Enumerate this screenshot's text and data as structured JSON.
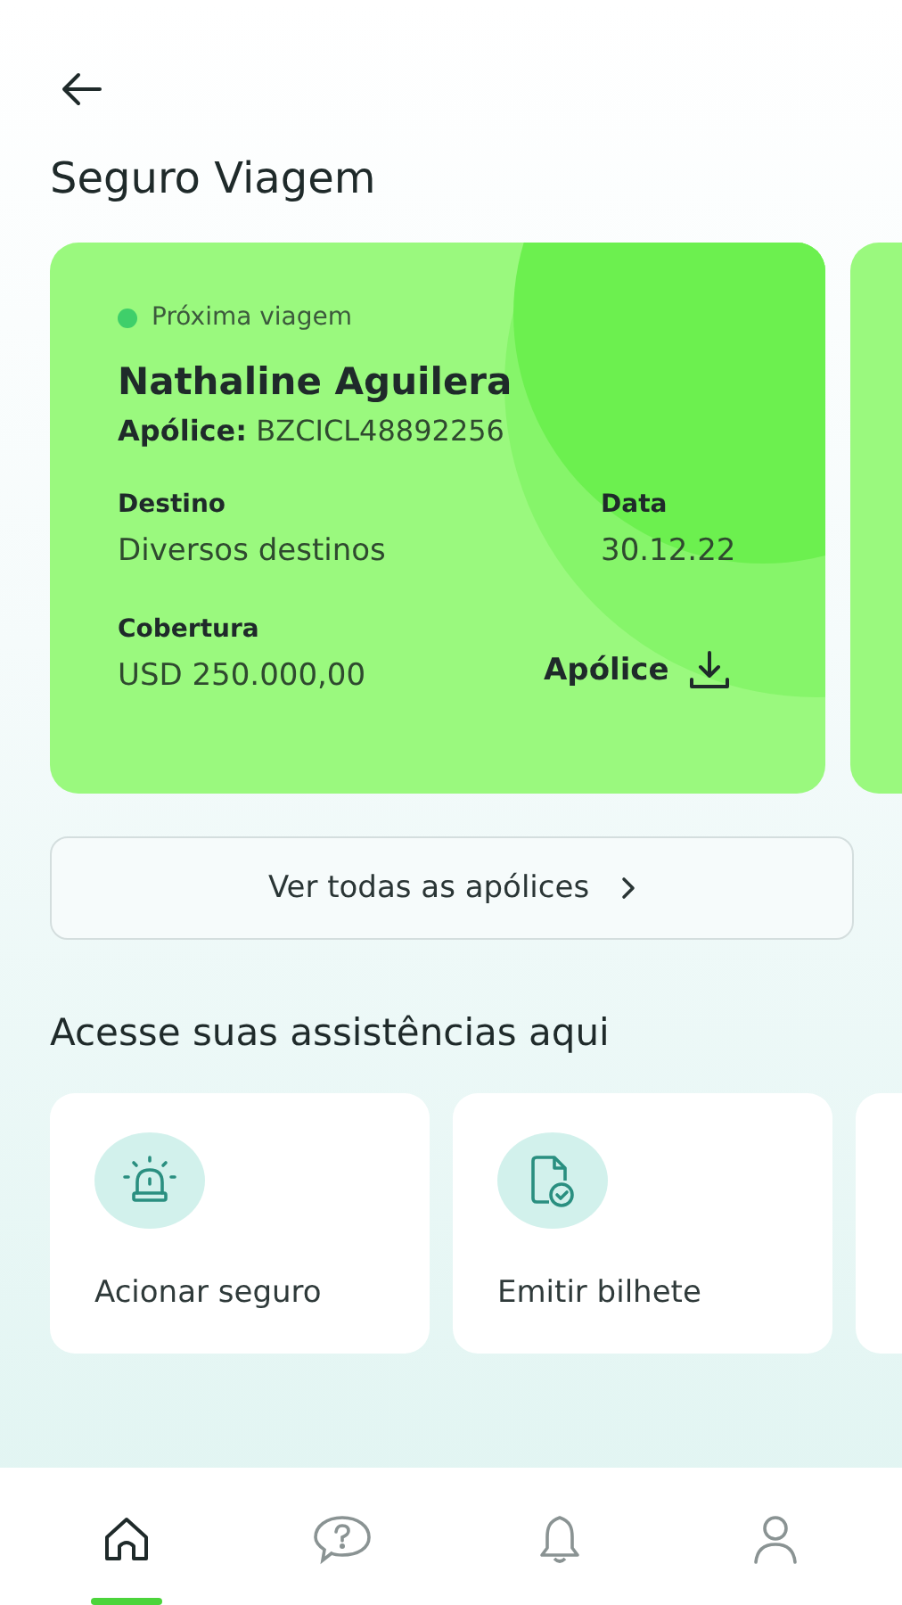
{
  "header": {
    "title": "Seguro Viagem"
  },
  "policy_card": {
    "status": {
      "label": "Próxima viagem",
      "color": "#3fcf6a"
    },
    "holder": "Nathaline Aguilera",
    "policy_label": "Apólice:",
    "policy_number": "BZCICL48892256",
    "fields": [
      {
        "label": "Destino",
        "value": "Diversos destinos"
      },
      {
        "label": "Data",
        "value": "30.12.22"
      },
      {
        "label": "Cobertura",
        "value": "USD 250.000,00"
      }
    ],
    "download_label": "Apólice"
  },
  "all_policies_button": "Ver todas as apólices",
  "assist_section": {
    "title": "Acesse suas assistências aqui",
    "items": [
      {
        "kind": "alarm",
        "label": "Acionar seguro"
      },
      {
        "kind": "document",
        "label": "Emitir bilhete"
      }
    ]
  },
  "bottom_nav": [
    {
      "kind": "home",
      "selected": true
    },
    {
      "kind": "help",
      "selected": false
    },
    {
      "kind": "bell",
      "selected": false
    },
    {
      "kind": "profile",
      "selected": false
    }
  ]
}
